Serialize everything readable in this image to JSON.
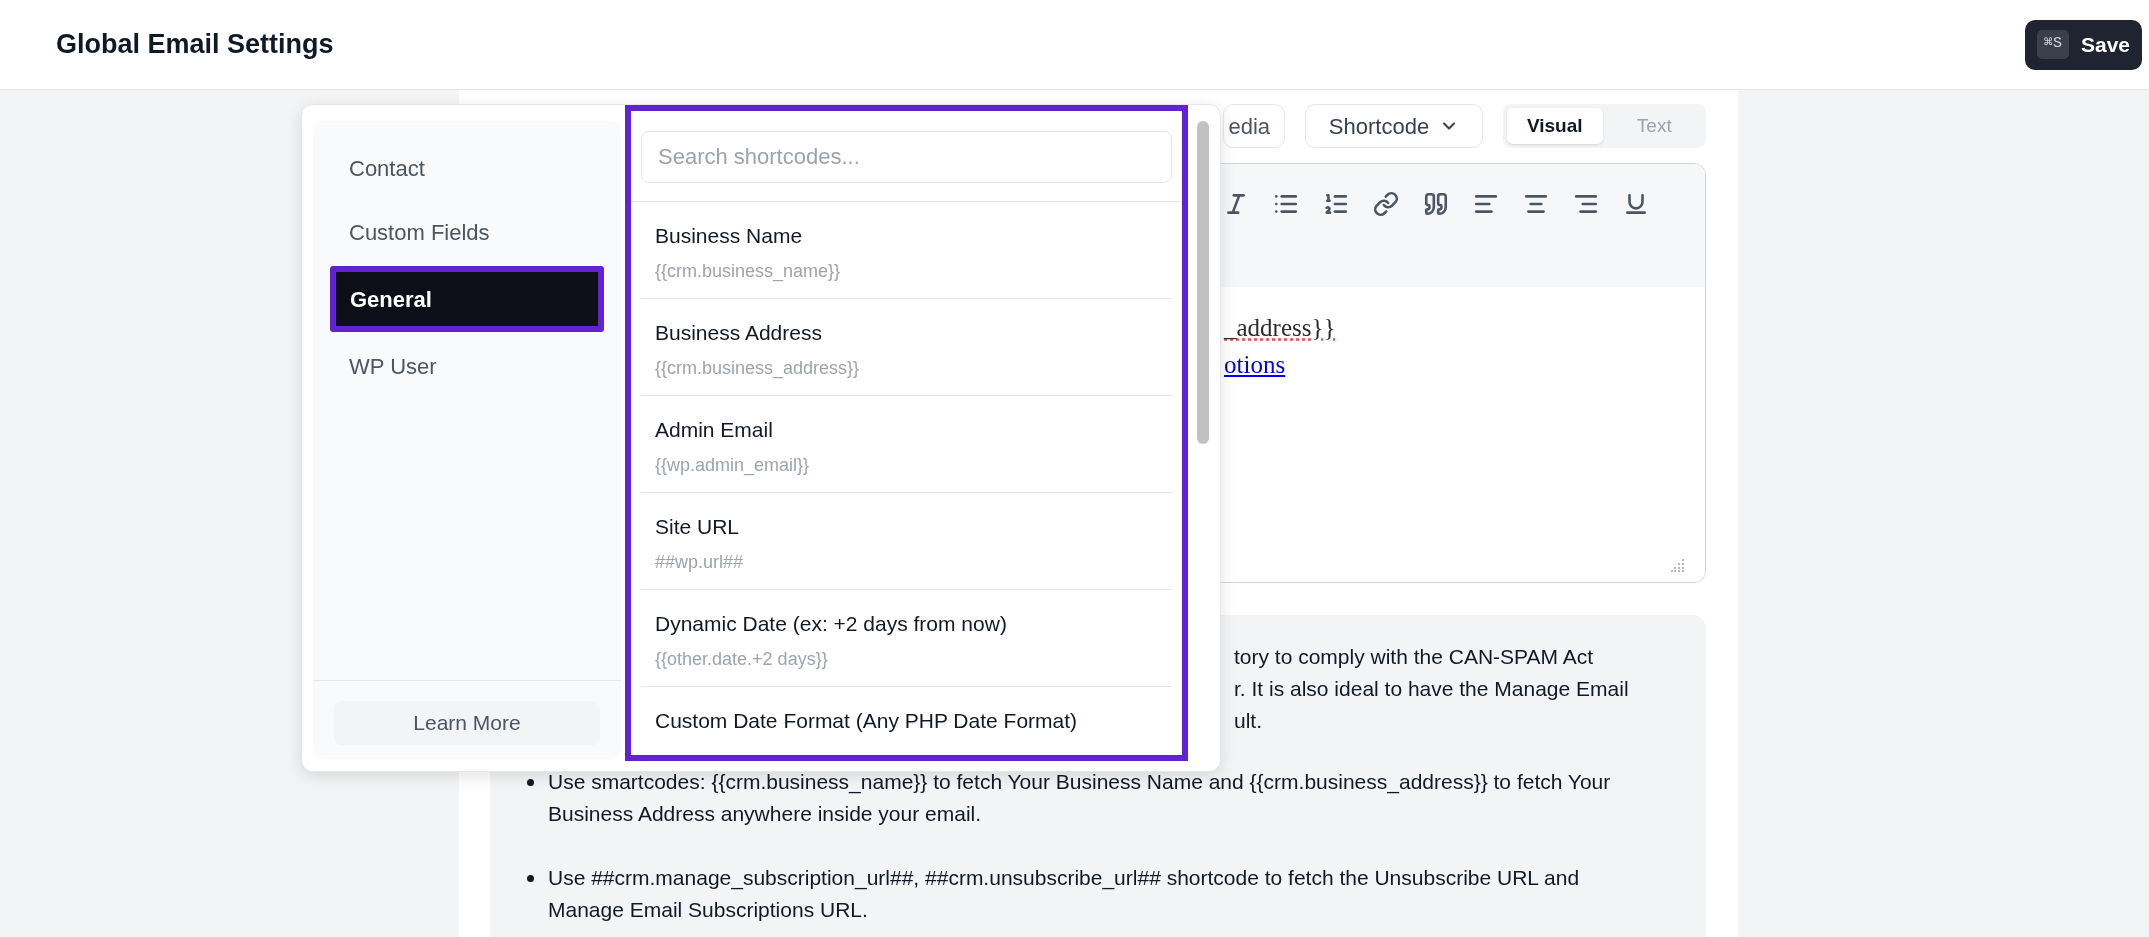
{
  "header": {
    "title": "Global Email Settings",
    "save_button": {
      "shortcut": "⌘S",
      "label": "Save"
    }
  },
  "editor": {
    "media_button": "edia",
    "shortcode_button": "Shortcode",
    "modes": [
      {
        "label": "Visual",
        "selected": true
      },
      {
        "label": "Text",
        "selected": false
      }
    ],
    "content_lines": [
      {
        "kind": "misspelled",
        "text": "_address}}"
      },
      {
        "kind": "link",
        "text": "otions"
      }
    ]
  },
  "info": {
    "fragments": [
      "tory to comply with the CAN-SPAM Act",
      "r. It is also ideal to have the Manage Email",
      "ult."
    ],
    "bullets": [
      "Use smartcodes: {{crm.business_name}} to fetch Your Business Name and {{crm.business_address}} to fetch Your Business Address anywhere inside your email.",
      "Use ##crm.manage_subscription_url##, ##crm.unsubscribe_url## shortcode to fetch the Unsubscribe URL and Manage Email Subscriptions URL."
    ]
  },
  "shortcode_popup": {
    "categories": [
      {
        "label": "Contact",
        "selected": false
      },
      {
        "label": "Custom Fields",
        "selected": false
      },
      {
        "label": "General",
        "selected": true
      },
      {
        "label": "WP User",
        "selected": false
      }
    ],
    "learn_more": "Learn More",
    "search": {
      "placeholder": "Search shortcodes..."
    },
    "items": [
      {
        "title": "Business Name",
        "code": "{{crm.business_name}}"
      },
      {
        "title": "Business Address",
        "code": "{{crm.business_address}}"
      },
      {
        "title": "Admin Email",
        "code": "{{wp.admin_email}}"
      },
      {
        "title": "Site URL",
        "code": "##wp.url##"
      },
      {
        "title": "Dynamic Date (ex: +2 days from now)",
        "code": "{{other.date.+2 days}}"
      },
      {
        "title": "Custom Date Format (Any PHP Date Format)"
      }
    ]
  }
}
